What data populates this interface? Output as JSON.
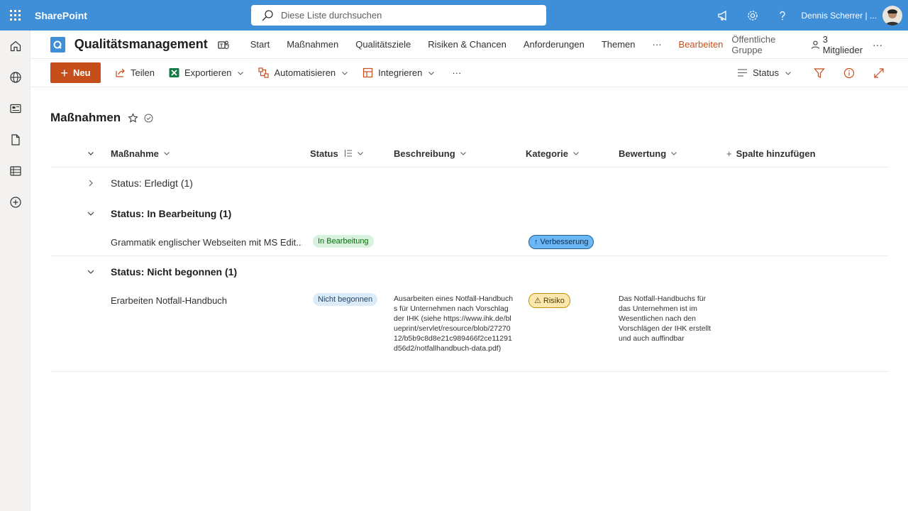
{
  "suite": {
    "brand": "SharePoint",
    "search_placeholder": "Diese Liste durchsuchen",
    "user": "Dennis Scherrer | ..."
  },
  "site": {
    "title": "Qualitätsmanagement",
    "nav": [
      "Start",
      "Maßnahmen",
      "Qualitätsziele",
      "Risiken & Chancen",
      "Anforderungen",
      "Themen",
      "···",
      "Bearbeiten"
    ],
    "group_type": "Öffentliche Gruppe",
    "members": "3 Mitglieder",
    "more": "···"
  },
  "commands": {
    "new": "Neu",
    "share": "Teilen",
    "export": "Exportieren",
    "automate": "Automatisieren",
    "integrate": "Integrieren",
    "more": "···",
    "view": "Status"
  },
  "list": {
    "title": "Maßnahmen",
    "columns": {
      "name": "Maßnahme",
      "status": "Status",
      "description": "Beschreibung",
      "category": "Kategorie",
      "rating": "Bewertung",
      "add": "Spalte hinzufügen",
      "add_plus": "+"
    },
    "groups": [
      {
        "label": "Status: Erledigt (1)",
        "expanded": false
      },
      {
        "label": "Status: In Bearbeitung (1)",
        "expanded": true
      },
      {
        "label": "Status: Nicht begonnen (1)",
        "expanded": true
      }
    ],
    "rows": [
      {
        "name": "Grammatik englischer Webseiten mit MS Edit...",
        "status": "In Bearbeitung",
        "description": "",
        "category": "↑ Verbesserung",
        "rating": ""
      },
      {
        "name": "Erarbeiten Notfall-Handbuch",
        "status": "Nicht begonnen",
        "description": "Ausarbeiten eines Notfall-Handbuchs für Unternehmen nach Vorschlag der IHK (siehe https://www.ihk.de/blueprint/servlet/resource/blob/2727012/b5b9c8d8e21c989466f2ce11291d56d2/notfallhandbuch-data.pdf)",
        "category": "⚠ Risiko",
        "rating": "Das Notfall-Handbuchs für das Unternehmen ist im Wesentlichen nach den Vorschlägen der IHK erstellt und auch auffindbar"
      }
    ]
  },
  "colors": {
    "suite_blue": "#3e8fd8",
    "accent": "#c64e1b",
    "pill_green": "#d9f2df",
    "pill_blue": "#dcebf8",
    "category_blue": "#6cb8f6",
    "category_yellow": "#fde7b0"
  }
}
